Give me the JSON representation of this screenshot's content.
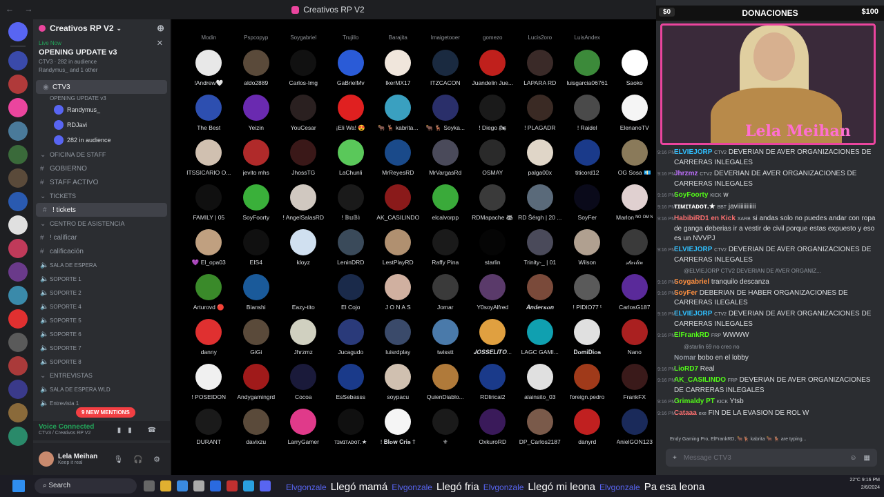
{
  "window": {
    "title": "Creativos RP V2"
  },
  "server": {
    "name": "Creativos RP V2"
  },
  "live_card": {
    "badge": "Live Now",
    "title": "OPENING UPDATE v3",
    "meta": "CTV3 · 282 in audience",
    "sub": "Randymus_ and 1 other"
  },
  "channels": [
    {
      "type": "stage",
      "label": "CTV3",
      "sub": "OPENING UPDATE v3",
      "selected": true
    },
    {
      "type": "voice-user",
      "label": "Randymus_"
    },
    {
      "type": "voice-user",
      "label": "RDJavi",
      "badge": "RDJV"
    },
    {
      "type": "voice-user",
      "label": "282 in audience"
    },
    {
      "type": "category",
      "label": "OFICINA DE STAFF"
    },
    {
      "type": "text",
      "label": "GOBIERNO"
    },
    {
      "type": "text",
      "label": "STAFF ACTIVO"
    },
    {
      "type": "category",
      "label": "TICKETS"
    },
    {
      "type": "text",
      "label": "! tickets",
      "selected": true
    },
    {
      "type": "category",
      "label": "CENTRO DE ASISTENCIA"
    },
    {
      "type": "text",
      "label": "! calificar"
    },
    {
      "type": "text",
      "label": "calificación"
    },
    {
      "type": "voice",
      "label": "SALA DE ESPERA"
    },
    {
      "type": "voice",
      "label": "SOPORTE 1"
    },
    {
      "type": "voice",
      "label": "SOPORTE 2"
    },
    {
      "type": "voice",
      "label": "SOPORTE 4"
    },
    {
      "type": "voice",
      "label": "SOPORTE 5"
    },
    {
      "type": "voice",
      "label": "SOPORTE 6"
    },
    {
      "type": "voice",
      "label": "SOPORTE 7"
    },
    {
      "type": "voice",
      "label": "SOPORTE 8"
    },
    {
      "type": "category",
      "label": "ENTREVISTAS"
    },
    {
      "type": "voice",
      "label": "SALA DE ESPERA WLD"
    },
    {
      "type": "voice",
      "label": "Entrevista 1"
    }
  ],
  "mentions_badge": "9 NEW MENTIONS",
  "voice_panel": {
    "status": "Voice Connected",
    "sub": "CTV3 / Creativos RP V2"
  },
  "user_panel": {
    "name": "Lela Meihan",
    "status": "Keep it real"
  },
  "top_names": [
    "Modin",
    "Pspcopyp",
    "Soygabriel",
    "Trujillo",
    "Barajita",
    "Imaigetooer",
    "gomezo",
    "Lucis2oro",
    "LuisAndex",
    ""
  ],
  "audience": [
    {
      "name": "!Andrew🤍",
      "color": "#e8e8e8"
    },
    {
      "name": "aldo2889",
      "color": "#5a4a3a"
    },
    {
      "name": "Carlos-Img",
      "color": "#111111"
    },
    {
      "name": "GaBrielMv",
      "color": "#2a5bd7"
    },
    {
      "name": "IkerMX17",
      "color": "#f0e6dc"
    },
    {
      "name": "ITZCACON",
      "color": "#1a2a40"
    },
    {
      "name": "Juandelin Jue...",
      "color": "#c0201c"
    },
    {
      "name": "LAPARA RD",
      "color": "#3a2a28"
    },
    {
      "name": "luisgarcia06761",
      "color": "#3c8a3a"
    },
    {
      "name": "Saoko",
      "color": "#ffffff"
    },
    {
      "name": "The Best",
      "color": "#2d4fb0"
    },
    {
      "name": "Yeizin",
      "color": "#6a2ab0"
    },
    {
      "name": "YouCesar",
      "color": "#2a2020"
    },
    {
      "name": "¡Eli Wa! 😍",
      "color": "#e02020"
    },
    {
      "name": "🐂 🦌 kabrita...",
      "color": "#3aa0c0"
    },
    {
      "name": "🐂 🦌 Soyka...",
      "color": "#2a2f6a"
    },
    {
      "name": "! Diego 🏍",
      "color": "#1a1a1a"
    },
    {
      "name": "! PLAGADR",
      "color": "#3a2a24"
    },
    {
      "name": "! Raidel",
      "color": "#4a4a4a"
    },
    {
      "name": "ElenanoTV",
      "color": "#f5f5f5"
    },
    {
      "name": "ITSSICARIO O...",
      "color": "#d0c0b0"
    },
    {
      "name": "jevito mhs",
      "color": "#b02a2a"
    },
    {
      "name": "JhossTG",
      "color": "#3a1818"
    },
    {
      "name": "LaChunli",
      "color": "#5ac85a"
    },
    {
      "name": "MrReyesRD",
      "color": "#1a4a8a"
    },
    {
      "name": "MrVargasRd",
      "color": "#4a4a5a"
    },
    {
      "name": "OSMAY",
      "color": "#2a2a2a"
    },
    {
      "name": "palga00x",
      "color": "#e0d6c8"
    },
    {
      "name": "titicord12",
      "color": "#1a3a8a"
    },
    {
      "name": "OG Sosa 💶",
      "color": "#8a7a5a"
    },
    {
      "name": "FAMILY | 05",
      "color": "#101010"
    },
    {
      "name": "SoyFoorty",
      "color": "#3ab03a"
    },
    {
      "name": "! AngelSalasRD",
      "color": "#d0c8c0"
    },
    {
      "name": "! 𝔹𝕦𝔹𝕚",
      "color": "#1a1a1a"
    },
    {
      "name": "AK_CASILINDO",
      "color": "#8a1a1a"
    },
    {
      "name": "elcalvorpp",
      "color": "#3aaa3a"
    },
    {
      "name": "RDMapache 🦝",
      "color": "#3a3a3a"
    },
    {
      "name": "RD Šérgh | 20 ...",
      "color": "#5a6a7a"
    },
    {
      "name": "SoyFer",
      "color": "#0a0a1a"
    },
    {
      "name": "Marlon ᴺᴼ ᴼᴹ ᴺ",
      "color": "#e0d0d0"
    },
    {
      "name": "💜 El_opa03",
      "color": "#c0a080"
    },
    {
      "name": "EIS4",
      "color": "#101010"
    },
    {
      "name": "kloyz",
      "color": "#d0e0f0"
    },
    {
      "name": "LeninDRD",
      "color": "#3a4a5a"
    },
    {
      "name": "LestPlayRD",
      "color": "#b09070"
    },
    {
      "name": "Raffy Pina",
      "color": "#1a1a1a"
    },
    {
      "name": "starlin",
      "color": "#050505"
    },
    {
      "name": "Trinity-_ | 01",
      "color": "#4a4a5a"
    },
    {
      "name": "Wilson",
      "color": "#b0a090"
    },
    {
      "name": "𝓈𝓉𝒶𝓇𝓁𝒾𝓃",
      "color": "#3a3a3a"
    },
    {
      "name": "Arturovd 🔴",
      "color": "#3a8a2a"
    },
    {
      "name": "Bianshi",
      "color": "#1a5a9a"
    },
    {
      "name": "Eazy-tito",
      "color": "#000000"
    },
    {
      "name": "El Cojo",
      "color": "#1a2a4a"
    },
    {
      "name": "J O N A S",
      "color": "#d0b0a0"
    },
    {
      "name": "Jomar",
      "color": "#3a3a3a"
    },
    {
      "name": "Y0soyAlfred",
      "color": "#5a3a6a"
    },
    {
      "name": "𝑨𝒏𝒅𝒆𝒓𝒔𝒐𝒏",
      "color": "#7a4a3a"
    },
    {
      "name": "! PIDIO77 ᵗ",
      "color": "#5a5a5a"
    },
    {
      "name": "CarlosG187",
      "color": "#5a2a9a"
    },
    {
      "name": "danny",
      "color": "#e03030"
    },
    {
      "name": "GiGi",
      "color": "#5a4a3a"
    },
    {
      "name": "Jhrzmz",
      "color": "#d0d0c0"
    },
    {
      "name": "Jucagudo",
      "color": "#2a3a7a"
    },
    {
      "name": "luisrdplay",
      "color": "#3a4a6a"
    },
    {
      "name": "twisstt",
      "color": "#4a7aaa"
    },
    {
      "name": "𝑱𝑶𝑺𝑺𝑬𝑳𝑰𝑻𝑶...",
      "color": "#e0a040"
    },
    {
      "name": "LAGC GAMI...",
      "color": "#10a0b0"
    },
    {
      "name": "𝐃𝐨𝐦𝐢𝐃𝐢𝐨𝐬",
      "color": "#e0e0e0"
    },
    {
      "name": "Nano",
      "color": "#aa2020"
    },
    {
      "name": "! POSEIDON",
      "color": "#f0f0f0"
    },
    {
      "name": "Andygamingrd",
      "color": "#a01a1a"
    },
    {
      "name": "Cocoa",
      "color": "#1a1a3a"
    },
    {
      "name": "EsSebasss",
      "color": "#1a3a8a"
    },
    {
      "name": "soypacu",
      "color": "#d0c0b0"
    },
    {
      "name": "QuienDiablo...",
      "color": "#b07a3a"
    },
    {
      "name": "RDlirical2",
      "color": "#1a3a8a"
    },
    {
      "name": "alainsito_03",
      "color": "#e0e0e0"
    },
    {
      "name": "foreign.pedro",
      "color": "#a03a1a"
    },
    {
      "name": "FrankFX",
      "color": "#3a1a1a"
    },
    {
      "name": "DURANT",
      "color": "#1a1a1a"
    },
    {
      "name": "davixzu",
      "color": "#5a4a3a"
    },
    {
      "name": "LarryGamer",
      "color": "#e03a8a"
    },
    {
      "name": "ᴛɪᴍɪᴛᴀᴅᴏᴛ.★",
      "color": "#101010"
    },
    {
      "name": "! 𝐁𝐥𝐨𝐰 𝐂𝐫𝐢𝐬 ✝",
      "color": "#f5f5f5"
    },
    {
      "name": "⚜",
      "color": "#1a1a1a"
    },
    {
      "name": "OxkuroRD",
      "color": "#3a1a5a"
    },
    {
      "name": "DP_Carlos2187",
      "color": "#7a5a4a"
    },
    {
      "name": "danyrd",
      "color": "#c02020"
    },
    {
      "name": "AnielGON123",
      "color": "#1a2a5a"
    }
  ],
  "donations": {
    "left": "$0",
    "title": "DONACIONES",
    "right": "$100"
  },
  "cam_label": "Lela Meihan",
  "chat": [
    {
      "time": "9:16 PM",
      "author": "ELVIEJORP",
      "badge": "CTV2",
      "text": "DEVERIAN DE AVER ORGANIZACIONES DE CARRERAS INLEGALES",
      "color": "#2fc0ff"
    },
    {
      "time": "9:16 PM",
      "author": "Jhrzmz",
      "badge": "CTV2",
      "text": "DEVERIAN DE AVER ORGANIZACIONES DE CARRERAS INLEGALES",
      "color": "#c070ff"
    },
    {
      "time": "9:16 PM",
      "author": "SoyFoorty",
      "badge": "KICK",
      "text": "w",
      "color": "#53fc18"
    },
    {
      "time": "9:16 PM",
      "author": "ᴛɪᴍɪᴛᴀᴅᴏᴛ.★",
      "badge": "BBT",
      "text": "javiiiiiiiiiiii",
      "color": "#ffffff"
    },
    {
      "time": "9:16 PM",
      "author": "HabibiRD1 en Kick",
      "badge": "XARB",
      "text": "si andas solo no puedes andar con ropa de ganga deberias ir a vestir de civil porque estas expuesto y eso es un NVVPJ",
      "color": "#ff7070"
    },
    {
      "time": "9:16 PM",
      "author": "ELVIEJORP",
      "badge": "CTV2",
      "text": "DEVERIAN DE AVER ORGANIZACIONES DE CARRERAS INLEGALES",
      "color": "#2fc0ff"
    },
    {
      "reply": "@ELVIEJORP  CTV2  DEVERIAN DE AVER ORGANIZ..."
    },
    {
      "time": "9:16 PM",
      "author": "Soygabriel",
      "badge": "",
      "text": "tranquilo descanza",
      "color": "#ff9040"
    },
    {
      "time": "9:16 PM",
      "author": "SoyFer",
      "badge": "",
      "text": "DEBERIAN DE HABER ORGANIZACIONES DE CARRERAS ILEGALES",
      "color": "#ff9040"
    },
    {
      "time": "9:16 PM",
      "author": "ELVIEJORP",
      "badge": "CTV2",
      "text": "DEVERIAN DE AVER ORGANIZACIONES DE CARRERAS INLEGALES",
      "color": "#2fc0ff"
    },
    {
      "time": "9:16 PM",
      "author": "ElFrankRD",
      "badge": "FRP",
      "text": "WWWW",
      "color": "#53fc18"
    },
    {
      "reply": "@starlin  69  no creo no"
    },
    {
      "time": "",
      "author": "Nomar",
      "badge": "",
      "text": "bobo en el lobby",
      "color": "#949ba4"
    },
    {
      "time": "9:16 PM",
      "author": "LioRD7",
      "badge": "",
      "text": "Real",
      "color": "#53fc18"
    },
    {
      "time": "9:16 PM",
      "author": "AK_CASILINDO",
      "badge": "FRP",
      "text": "DEVERIAN DE AVER ORGANIZACIONES DE CARRERAS INLEGALES",
      "color": "#53fc18"
    },
    {
      "time": "9:16 PM",
      "author": "Grimaldy PT",
      "badge": "KICK",
      "text": "Ytsb",
      "color": "#53fc18"
    },
    {
      "time": "9:16 PM",
      "author": "Cataaa",
      "badge": "exe",
      "text": "FIN DE LA EVASION DE ROL W",
      "color": "#ff7070"
    }
  ],
  "typing": "Endy Gaming Pro, ElFrankRD, 🐂🦌 kabrita 🐂 🦌 are typing...",
  "message_placeholder": "Message CTV3",
  "taskbar": {
    "search": "Search",
    "time": "9:16 PM",
    "date": "2/6/2024",
    "temp": "22°C"
  },
  "ticker": [
    "Llegó mamá",
    "Llegó fria",
    "Llegó mi leona",
    "Pa esa leona"
  ],
  "ticker_handle": "Elvgonzale"
}
